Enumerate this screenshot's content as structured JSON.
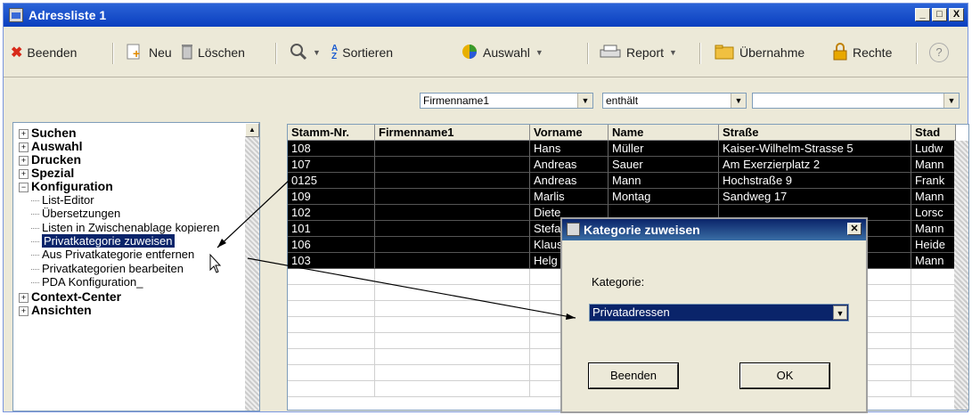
{
  "window": {
    "title": "Adressliste 1",
    "controls": [
      "_",
      "□",
      "X"
    ]
  },
  "toolbar": {
    "beenden": "Beenden",
    "neu": "Neu",
    "loeschen": "Löschen",
    "sortieren": "Sortieren",
    "auswahl": "Auswahl",
    "report": "Report",
    "uebernahme": "Übernahme",
    "rechte": "Rechte"
  },
  "filter": {
    "field": "Firmenname1",
    "operator": "enthält",
    "value": ""
  },
  "tree": {
    "suchen": "Suchen",
    "auswahl": "Auswahl",
    "drucken": "Drucken",
    "spezial": "Spezial",
    "konfiguration": "Konfiguration",
    "items": [
      "List-Editor",
      "Übersetzungen",
      "Listen in Zwischenablage kopieren",
      "Privatkategorie zuweisen",
      "Aus Privatkategorie entfernen",
      "Privatkategorien bearbeiten",
      "PDA Konfiguration_"
    ],
    "context": "Context-Center",
    "ansichten": "Ansichten"
  },
  "grid": {
    "columns": [
      "Stamm-Nr.",
      "Firmenname1",
      "Vorname",
      "Name",
      "Straße",
      "Stad"
    ],
    "rows": [
      [
        "108",
        "",
        "Hans",
        "Müller",
        "Kaiser-Wilhelm-Strasse 5",
        "Ludw"
      ],
      [
        "107",
        "",
        "Andreas",
        "Sauer",
        "Am Exerzierplatz 2",
        "Mann"
      ],
      [
        "0125",
        "",
        "Andreas",
        "Mann",
        "Hochstraße 9",
        "Frank"
      ],
      [
        "109",
        "",
        "Marlis",
        "Montag",
        "Sandweg 17",
        "Mann"
      ],
      [
        "102",
        "",
        "Diete",
        "",
        "",
        "Lorsc"
      ],
      [
        "101",
        "",
        "Stefa",
        "",
        "",
        "Mann"
      ],
      [
        "106",
        "",
        "Klaus",
        "",
        "",
        "Heide"
      ],
      [
        "103",
        "",
        "Helg",
        "",
        "",
        "Mann"
      ]
    ]
  },
  "dialog": {
    "title": "Kategorie zuweisen",
    "label": "Kategorie:",
    "value": "Privatadressen",
    "cancel": "Beenden",
    "ok": "OK"
  }
}
